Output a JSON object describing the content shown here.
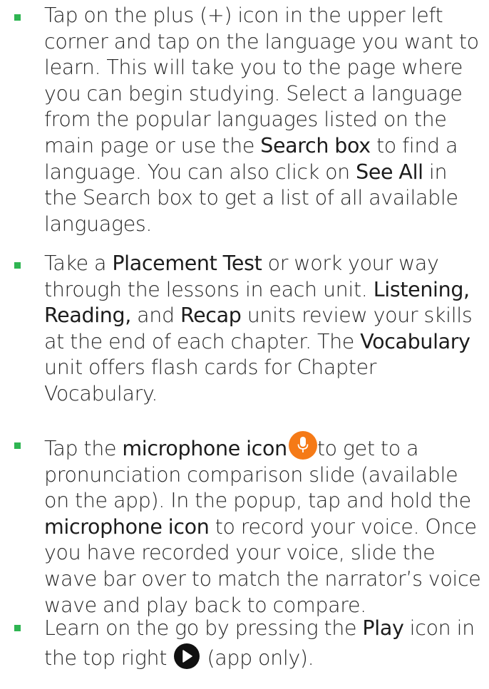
{
  "bullets": [
    {
      "segments": [
        {
          "text": "Tap on the plus (+) icon in the upper left corner and tap on the language you want to learn. This will take you to the page where you can begin studying. Select a language from the popular languages listed on the main page or use the ",
          "bold": false
        },
        {
          "text": "Search box",
          "bold": true
        },
        {
          "text": " to find a language. You can also click on ",
          "bold": false
        },
        {
          "text": "See All",
          "bold": true
        },
        {
          "text": " in the Search box to get a list of all available languages.",
          "bold": false
        }
      ]
    },
    {
      "segments": [
        {
          "text": "Take a ",
          "bold": false
        },
        {
          "text": "Placement Test",
          "bold": true
        },
        {
          "text": " or work your way through the lessons in each unit. ",
          "bold": false
        },
        {
          "text": "Listening, Reading,",
          "bold": true
        },
        {
          "text": " and ",
          "bold": false
        },
        {
          "text": "Recap",
          "bold": true
        },
        {
          "text": " units review your skills at the end of each chapter. The ",
          "bold": false
        },
        {
          "text": "Vocabulary",
          "bold": true
        },
        {
          "text": " unit offers flash cards for Chapter Vocabulary.",
          "bold": false
        }
      ]
    },
    {
      "segments": [
        {
          "text": "Tap the ",
          "bold": false
        },
        {
          "text": "microphone icon",
          "bold": true
        },
        {
          "icon": "microphone-icon"
        },
        {
          "text": "to get to a pronunciation comparison slide (available on the app). In the popup, tap and hold the ",
          "bold": false
        },
        {
          "text": "microphone icon",
          "bold": true
        },
        {
          "text": " to record your voice. Once you have recorded your voice, slide the wave bar over to match the narrator’s voice wave and play back to compare.",
          "bold": false
        }
      ]
    },
    {
      "segments": [
        {
          "text": "Learn on the go by pressing the ",
          "bold": false
        },
        {
          "text": "Play",
          "bold": true
        },
        {
          "text": " icon in the top right ",
          "bold": false
        },
        {
          "icon": "play-icon"
        },
        {
          "text": " (app only).",
          "bold": false
        }
      ]
    }
  ],
  "colors": {
    "bullet": "#2fb552",
    "microphone_icon": "#f57a17",
    "play_icon": "#111111"
  }
}
